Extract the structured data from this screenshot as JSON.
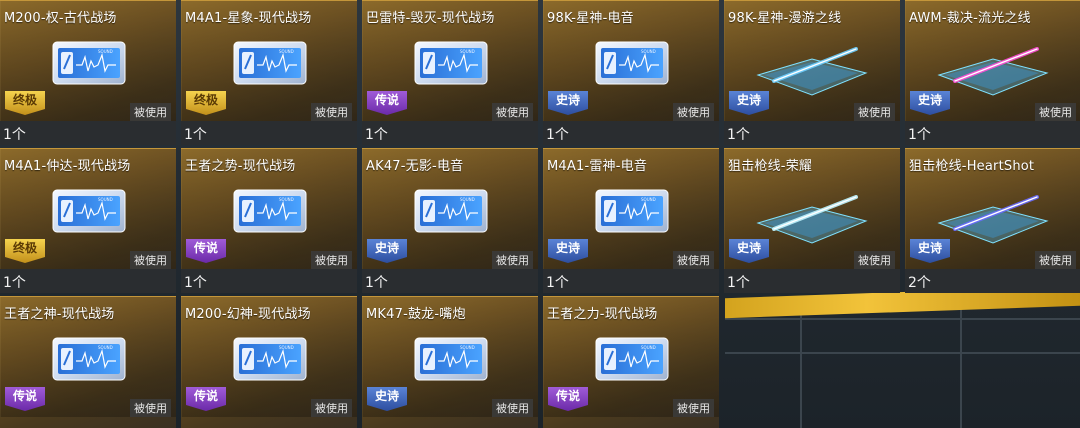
{
  "cards": [
    {
      "title": "M200-权-古代战场",
      "rarity": "终极",
      "rarity_key": "ultimate",
      "icon": "sound-ticket-icon",
      "status": "被使用",
      "count": "1个"
    },
    {
      "title": "M4A1-星象-现代战场",
      "rarity": "终极",
      "rarity_key": "ultimate",
      "icon": "sound-ticket-icon",
      "status": "被使用",
      "count": "1个"
    },
    {
      "title": "巴雷特-毁灭-现代战场",
      "rarity": "传说",
      "rarity_key": "legend",
      "icon": "sound-ticket-icon",
      "status": "被使用",
      "count": "1个"
    },
    {
      "title": "98K-星神-电音",
      "rarity": "史诗",
      "rarity_key": "epic",
      "icon": "sound-ticket-icon",
      "status": "被使用",
      "count": "1个"
    },
    {
      "title": "98K-星神-漫游之线",
      "rarity": "史诗",
      "rarity_key": "epic",
      "icon": "laser-line-icon",
      "laser_color": "#6fd0ff",
      "status": "被使用",
      "count": "1个"
    },
    {
      "title": "AWM-裁决-流光之线",
      "rarity": "史诗",
      "rarity_key": "epic",
      "icon": "laser-line-icon",
      "laser_color": "#ff4fd8",
      "status": "被使用",
      "count": "1个"
    },
    {
      "title": "M4A1-仲达-现代战场",
      "rarity": "终极",
      "rarity_key": "ultimate",
      "icon": "sound-ticket-icon",
      "status": "被使用",
      "count": "1个"
    },
    {
      "title": "王者之势-现代战场",
      "rarity": "传说",
      "rarity_key": "legend",
      "icon": "sound-ticket-icon",
      "status": "被使用",
      "count": "1个"
    },
    {
      "title": "AK47-无影-电音",
      "rarity": "史诗",
      "rarity_key": "epic",
      "icon": "sound-ticket-icon",
      "status": "被使用",
      "count": "1个"
    },
    {
      "title": "M4A1-雷神-电音",
      "rarity": "史诗",
      "rarity_key": "epic",
      "icon": "sound-ticket-icon",
      "status": "被使用",
      "count": "1个"
    },
    {
      "title": "狙击枪线-荣耀",
      "rarity": "史诗",
      "rarity_key": "epic",
      "icon": "laser-line-icon",
      "laser_color": "#bff4ff",
      "status": "被使用",
      "count": "1个"
    },
    {
      "title": "狙击枪线-HeartShot",
      "rarity": "史诗",
      "rarity_key": "epic",
      "icon": "laser-line-icon",
      "laser_color": "#6a6cff",
      "status": "被使用",
      "count": "2个"
    },
    {
      "title": "王者之神-现代战场",
      "rarity": "传说",
      "rarity_key": "legend",
      "icon": "sound-ticket-icon",
      "status": "被使用",
      "count": ""
    },
    {
      "title": "M200-幻神-现代战场",
      "rarity": "传说",
      "rarity_key": "legend",
      "icon": "sound-ticket-icon",
      "status": "被使用",
      "count": ""
    },
    {
      "title": "MK47-鼓龙-嘴炮",
      "rarity": "史诗",
      "rarity_key": "epic",
      "icon": "sound-ticket-icon",
      "status": "被使用",
      "count": ""
    },
    {
      "title": "王者之力-现代战场",
      "rarity": "传说",
      "rarity_key": "legend",
      "icon": "sound-ticket-icon",
      "status": "被使用",
      "count": ""
    }
  ],
  "ticket_label": "SOUND"
}
